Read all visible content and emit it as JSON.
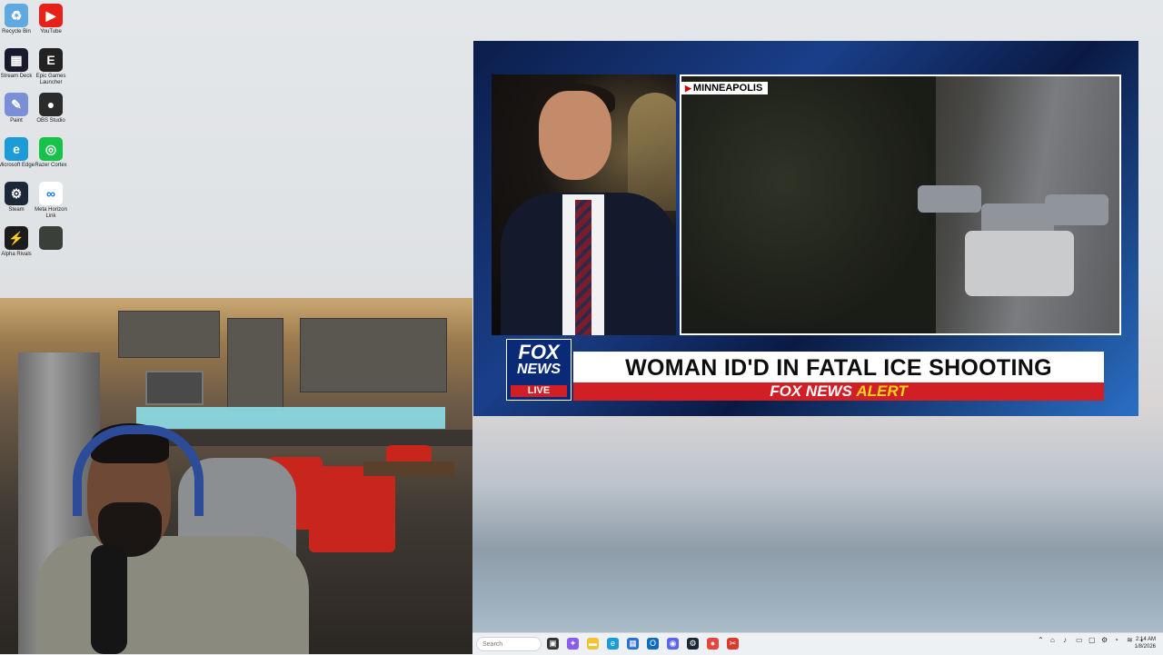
{
  "desktop": {
    "icons": [
      {
        "label": "Recycle Bin",
        "icon": "recycle-bin-icon",
        "color": "#5fa9e0",
        "glyph": "♻"
      },
      {
        "label": "YouTube",
        "icon": "youtube-icon",
        "color": "#e62117",
        "glyph": "▶"
      },
      {
        "label": "Stream Deck",
        "icon": "stream-deck-icon",
        "color": "#1a1a2e",
        "glyph": "▦"
      },
      {
        "label": "Epic Games Launcher",
        "icon": "epic-games-icon",
        "color": "#222222",
        "glyph": "E"
      },
      {
        "label": "Paint",
        "icon": "paint-icon",
        "color": "#7a8fd8",
        "glyph": "✎"
      },
      {
        "label": "OBS Studio",
        "icon": "obs-icon",
        "color": "#2b2b2b",
        "glyph": "●"
      },
      {
        "label": "Microsoft Edge",
        "icon": "edge-icon",
        "color": "#1b9bd7",
        "glyph": "e"
      },
      {
        "label": "Razer Cortex",
        "icon": "razer-cortex-icon",
        "color": "#17c24a",
        "glyph": "◎"
      },
      {
        "label": "Steam",
        "icon": "steam-icon",
        "color": "#1b2838",
        "glyph": "⚙"
      },
      {
        "label": "Meta Horizon Link",
        "icon": "meta-icon",
        "color": "#ffffff",
        "glyph": "∞"
      },
      {
        "label": "Alpha Rivals",
        "icon": "game-icon",
        "color": "#1c1c1c",
        "glyph": "⚡"
      },
      {
        "label": "",
        "icon": "game-thumbnail-icon",
        "color": "#3a3f3a",
        "glyph": ""
      }
    ]
  },
  "news": {
    "location_tag": "MINNEAPOLIS",
    "logo_line1": "FOX",
    "logo_line2": "NEWS",
    "logo_live": "LIVE",
    "headline": "WOMAN ID'D IN FATAL ICE SHOOTING",
    "alert_brand": "FOX NEWS",
    "alert_word": "ALERT"
  },
  "taskbar": {
    "search_placeholder": "Search",
    "apps": [
      {
        "icon": "task-view-icon",
        "color": "#333333",
        "glyph": "▣"
      },
      {
        "icon": "copilot-icon",
        "color": "#8a5cf0",
        "glyph": "✦"
      },
      {
        "icon": "file-explorer-icon",
        "color": "#f2c230",
        "glyph": "▬"
      },
      {
        "icon": "edge-icon",
        "color": "#1b9bd7",
        "glyph": "e"
      },
      {
        "icon": "store-icon",
        "color": "#2a6fd6",
        "glyph": "▦"
      },
      {
        "icon": "outlook-icon",
        "color": "#0f6cbd",
        "glyph": "O"
      },
      {
        "icon": "discord-icon",
        "color": "#5865f2",
        "glyph": "◉"
      },
      {
        "icon": "steam-icon",
        "color": "#1b2838",
        "glyph": "⚙"
      },
      {
        "icon": "chrome-icon",
        "color": "#e8453c",
        "glyph": "●"
      },
      {
        "icon": "snipping-tool-icon",
        "color": "#d93a2b",
        "glyph": "✂"
      }
    ],
    "tray_icons": [
      "chevron-up-icon",
      "network-icon",
      "volume-icon",
      "battery-icon",
      "display-icon",
      "settings-icon",
      "notification-icon",
      "wifi-icon",
      "speaker-icon"
    ],
    "time": "2:14 AM",
    "date": "1/8/2026"
  }
}
